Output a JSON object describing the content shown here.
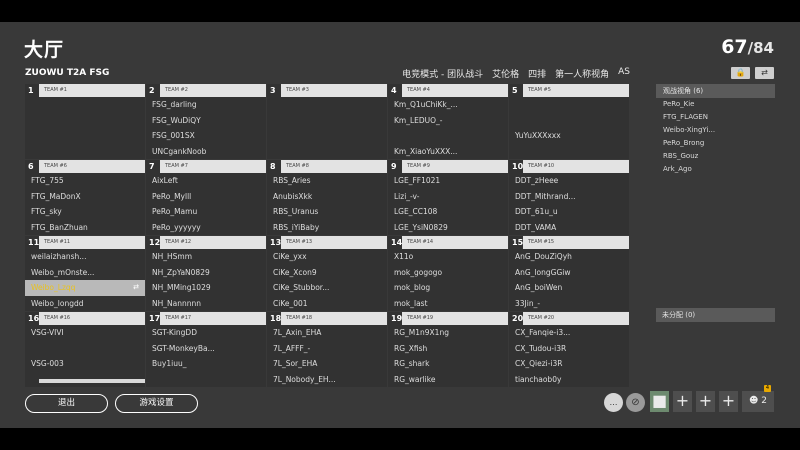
{
  "header": {
    "title": "大厅",
    "player_count": "67",
    "player_total": "/84",
    "match_name": "ZUOWU T2A FSG"
  },
  "modes": [
    "电竞模式 - 团队战斗",
    "艾伦格",
    "四排",
    "第一人称视角",
    "AS"
  ],
  "controls": {
    "lock_icon": "lock-icon",
    "swap_icon": "swap-icon"
  },
  "teams": [
    {
      "num": "1",
      "name": "TEAM #1",
      "slots": [
        "",
        "",
        "",
        ""
      ]
    },
    {
      "num": "2",
      "name": "TEAM #2",
      "slots": [
        "FSG_darling",
        "FSG_WuDiQY",
        "FSG_001SX",
        "UNCgankNoob"
      ]
    },
    {
      "num": "3",
      "name": "TEAM #3",
      "slots": [
        "",
        "",
        "",
        ""
      ]
    },
    {
      "num": "4",
      "name": "TEAM #4",
      "slots": [
        "Km_Q1uChiKk_...",
        "Km_LEDUO_-",
        "",
        "Km_XiaoYuXXX..."
      ]
    },
    {
      "num": "5",
      "name": "TEAM #5",
      "slots": [
        "",
        "",
        "YuYuXXXxxx",
        ""
      ]
    },
    {
      "num": "6",
      "name": "TEAM #6",
      "slots": [
        "FTG_755",
        "FTG_MaDonX",
        "FTG_sky",
        "FTG_BanZhuan"
      ]
    },
    {
      "num": "7",
      "name": "TEAM #7",
      "slots": [
        "AixLeft",
        "PeRo_Mylll",
        "PeRo_Mamu",
        "PeRo_yyyyyy"
      ]
    },
    {
      "num": "8",
      "name": "TEAM #8",
      "slots": [
        "RBS_Aries",
        "AnubisXkk",
        "RBS_Uranus",
        "RBS_iYiBaby"
      ]
    },
    {
      "num": "9",
      "name": "TEAM #9",
      "slots": [
        "LGE_FF1021",
        "Lizi_-v-",
        "LGE_CC108",
        "LGE_YsiN0829"
      ]
    },
    {
      "num": "10",
      "name": "TEAM #10",
      "slots": [
        "DDT_zHeee",
        "DDT_Mithrand...",
        "DDT_61u_u",
        "DDT_VAMA"
      ]
    },
    {
      "num": "11",
      "name": "TEAM #11",
      "slots": [
        "weilaizhansh...",
        "Weibo_mOnste...",
        "Weibo_Lzqq",
        "Weibo_longdd"
      ]
    },
    {
      "num": "12",
      "name": "TEAM #12",
      "slots": [
        "NH_HSmm",
        "NH_ZpYaN0829",
        "NH_MMing1029",
        "NH_Nannnnn"
      ]
    },
    {
      "num": "13",
      "name": "TEAM #13",
      "slots": [
        "CiKe_yxx",
        "CiKe_Xcon9",
        "CiKe_Stubbor...",
        "CiKe_001"
      ]
    },
    {
      "num": "14",
      "name": "TEAM #14",
      "slots": [
        "X11o",
        "mok_gogogo",
        "mok_blog",
        "mok_last"
      ]
    },
    {
      "num": "15",
      "name": "TEAM #15",
      "slots": [
        "AnG_DouZiQyh",
        "AnG_longGGiw",
        "AnG_boiWen",
        "33Jin_-"
      ]
    },
    {
      "num": "16",
      "name": "TEAM #16",
      "slots": [
        "VSG-VIVI",
        "",
        "VSG-003",
        ""
      ]
    },
    {
      "num": "17",
      "name": "TEAM #17",
      "slots": [
        "SGT-KingDD",
        "SGT-MonkeyBa...",
        "Buy1iuu_",
        ""
      ]
    },
    {
      "num": "18",
      "name": "TEAM #18",
      "slots": [
        "7L_Axin_EHA",
        "7L_AFFF_-",
        "7L_Sor_EHA",
        "7L_Nobody_EH..."
      ]
    },
    {
      "num": "19",
      "name": "TEAM #19",
      "slots": [
        "RG_M1n9X1ng",
        "RG_Xfish",
        "RG_shark",
        "RG_warlike"
      ]
    },
    {
      "num": "20",
      "name": "TEAM #20",
      "slots": [
        "CX_Fanqie-i3...",
        "CX_Tudou-i3R",
        "CX_Qiezi-i3R",
        "tianchaob0y"
      ]
    }
  ],
  "selected_slot": {
    "team_index": 10,
    "slot_index": 2
  },
  "spectators": {
    "header": "观战视角 (6)",
    "items": [
      "PeRo_Kie",
      "FTG_FLAGEN",
      "Weibo-XingYi...",
      "PeRo_Brong",
      "RBS_Gouz",
      "Ark_Ago"
    ]
  },
  "unassigned": {
    "header": "未分配 (0)"
  },
  "footer": {
    "exit_label": "退出",
    "settings_label": "游戏设置",
    "party_count": "2",
    "badge": "4"
  }
}
